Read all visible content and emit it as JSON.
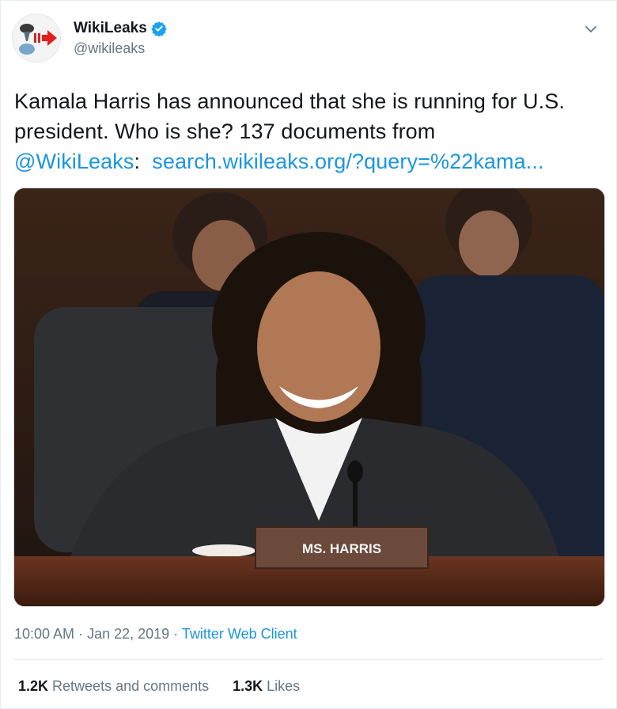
{
  "author": {
    "display_name": "WikiLeaks",
    "handle": "@wikileaks",
    "verified": true,
    "avatar_icon": "wikileaks-hourglass-logo",
    "verified_icon": "verified-badge-icon"
  },
  "tweet": {
    "text_plain": "Kamala Harris has announced that she is running for U.S. president. Who is she? 137 documents from",
    "mention": "@WikiLeaks",
    "separator": ":",
    "link": "search.wikileaks.org/?query=%22kama..."
  },
  "media": {
    "nameplate_text": "MS. HARRIS"
  },
  "meta": {
    "time": "10:00 AM",
    "sep1": "·",
    "date": "Jan 22, 2019",
    "sep2": "·",
    "source": "Twitter Web Client"
  },
  "stats": {
    "retweets_count": "1.2K",
    "retweets_label": "Retweets and comments",
    "likes_count": "1.3K",
    "likes_label": "Likes"
  },
  "colors": {
    "link": "#1b95e0",
    "verified": "#1da1f2",
    "muted": "#657786"
  },
  "icons": {
    "menu": "chevron-down-icon"
  }
}
